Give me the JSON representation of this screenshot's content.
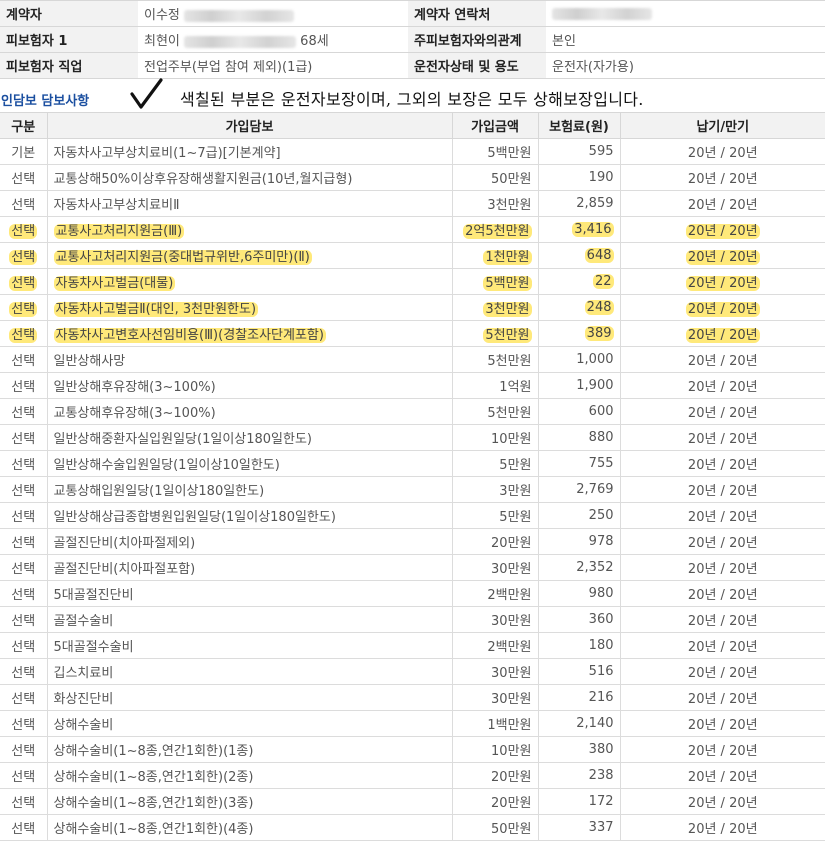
{
  "header": {
    "rows": [
      {
        "label1": "계약자",
        "value1": "이수정",
        "label2": "계약자 연락처",
        "value2": ""
      },
      {
        "label1": "피보험자 1",
        "value1": "최현이",
        "value1_suffix": "68세",
        "label2": "주피보험자와의관계",
        "value2": "본인"
      },
      {
        "label1": "피보험자 직업",
        "value1": "전업주부(부업 참여 제외)(1급)",
        "label2": "운전자상태 및 용도",
        "value2": "운전자(자가용)"
      }
    ]
  },
  "section": {
    "title": "인담보 담보사항",
    "notice": "색칠된 부분은 운전자보장이며, 그외의 보장은 모두 상해보장입니다."
  },
  "table": {
    "columns": [
      "구분",
      "가입담보",
      "가입금액",
      "보험료(원)",
      "납기/만기"
    ],
    "rows": [
      {
        "type": "기본",
        "name": "자동차사고부상치료비(1~7급)[기본계약]",
        "amount": "5백만원",
        "premium": "595",
        "term": "20년 / 20년",
        "highlight": false
      },
      {
        "type": "선택",
        "name": "교통상해50%이상후유장해생활지원금(10년,월지급형)",
        "amount": "50만원",
        "premium": "190",
        "term": "20년 / 20년",
        "highlight": false
      },
      {
        "type": "선택",
        "name": "자동차사고부상치료비Ⅱ",
        "amount": "3천만원",
        "premium": "2,859",
        "term": "20년 / 20년",
        "highlight": false
      },
      {
        "type": "선택",
        "name": "교통사고처리지원금(Ⅲ)",
        "amount": "2억5천만원",
        "premium": "3,416",
        "term": "20년 / 20년",
        "highlight": true
      },
      {
        "type": "선택",
        "name": "교통사고처리지원금(중대법규위반,6주미만)(Ⅱ)",
        "amount": "1천만원",
        "premium": "648",
        "term": "20년 / 20년",
        "highlight": true
      },
      {
        "type": "선택",
        "name": "자동차사고벌금(대물)",
        "amount": "5백만원",
        "premium": "22",
        "term": "20년 / 20년",
        "highlight": true
      },
      {
        "type": "선택",
        "name": "자동차사고벌금Ⅱ(대인, 3천만원한도)",
        "amount": "3천만원",
        "premium": "248",
        "term": "20년 / 20년",
        "highlight": true
      },
      {
        "type": "선택",
        "name": "자동차사고변호사선임비용(Ⅲ)(경찰조사단계포함)",
        "amount": "5천만원",
        "premium": "389",
        "term": "20년 / 20년",
        "highlight": true
      },
      {
        "type": "선택",
        "name": "일반상해사망",
        "amount": "5천만원",
        "premium": "1,000",
        "term": "20년 / 20년",
        "highlight": false
      },
      {
        "type": "선택",
        "name": "일반상해후유장해(3~100%)",
        "amount": "1억원",
        "premium": "1,900",
        "term": "20년 / 20년",
        "highlight": false
      },
      {
        "type": "선택",
        "name": "교통상해후유장해(3~100%)",
        "amount": "5천만원",
        "premium": "600",
        "term": "20년 / 20년",
        "highlight": false
      },
      {
        "type": "선택",
        "name": "일반상해중환자실입원일당(1일이상180일한도)",
        "amount": "10만원",
        "premium": "880",
        "term": "20년 / 20년",
        "highlight": false
      },
      {
        "type": "선택",
        "name": "일반상해수술입원일당(1일이상10일한도)",
        "amount": "5만원",
        "premium": "755",
        "term": "20년 / 20년",
        "highlight": false
      },
      {
        "type": "선택",
        "name": "교통상해입원일당(1일이상180일한도)",
        "amount": "3만원",
        "premium": "2,769",
        "term": "20년 / 20년",
        "highlight": false
      },
      {
        "type": "선택",
        "name": "일반상해상급종합병원입원일당(1일이상180일한도)",
        "amount": "5만원",
        "premium": "250",
        "term": "20년 / 20년",
        "highlight": false
      },
      {
        "type": "선택",
        "name": "골절진단비(치아파절제외)",
        "amount": "20만원",
        "premium": "978",
        "term": "20년 / 20년",
        "highlight": false
      },
      {
        "type": "선택",
        "name": "골절진단비(치아파절포함)",
        "amount": "30만원",
        "premium": "2,352",
        "term": "20년 / 20년",
        "highlight": false
      },
      {
        "type": "선택",
        "name": "5대골절진단비",
        "amount": "2백만원",
        "premium": "980",
        "term": "20년 / 20년",
        "highlight": false
      },
      {
        "type": "선택",
        "name": "골절수술비",
        "amount": "30만원",
        "premium": "360",
        "term": "20년 / 20년",
        "highlight": false
      },
      {
        "type": "선택",
        "name": "5대골절수술비",
        "amount": "2백만원",
        "premium": "180",
        "term": "20년 / 20년",
        "highlight": false
      },
      {
        "type": "선택",
        "name": "깁스치료비",
        "amount": "30만원",
        "premium": "516",
        "term": "20년 / 20년",
        "highlight": false
      },
      {
        "type": "선택",
        "name": "화상진단비",
        "amount": "30만원",
        "premium": "216",
        "term": "20년 / 20년",
        "highlight": false
      },
      {
        "type": "선택",
        "name": "상해수술비",
        "amount": "1백만원",
        "premium": "2,140",
        "term": "20년 / 20년",
        "highlight": false
      },
      {
        "type": "선택",
        "name": "상해수술비(1~8종,연간1회한)(1종)",
        "amount": "10만원",
        "premium": "380",
        "term": "20년 / 20년",
        "highlight": false
      },
      {
        "type": "선택",
        "name": "상해수술비(1~8종,연간1회한)(2종)",
        "amount": "20만원",
        "premium": "238",
        "term": "20년 / 20년",
        "highlight": false
      },
      {
        "type": "선택",
        "name": "상해수술비(1~8종,연간1회한)(3종)",
        "amount": "20만원",
        "premium": "172",
        "term": "20년 / 20년",
        "highlight": false
      },
      {
        "type": "선택",
        "name": "상해수술비(1~8종,연간1회한)(4종)",
        "amount": "50만원",
        "premium": "337",
        "term": "20년 / 20년",
        "highlight": false
      }
    ]
  },
  "colors": {
    "highlight": "#ffe97a",
    "section_title": "#1b4fa0",
    "label_bg": "#f2f2f2"
  },
  "icons": {
    "notice_mark": "checkmark-icon"
  }
}
